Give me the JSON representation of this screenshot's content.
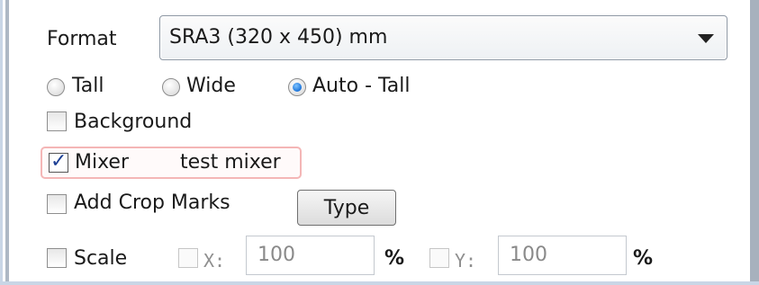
{
  "format": {
    "label": "Format",
    "selected": "SRA3 (320 x 450) mm"
  },
  "orientation": {
    "options": [
      {
        "label": "Tall",
        "checked": false
      },
      {
        "label": "Wide",
        "checked": false
      },
      {
        "label": "Auto - Tall",
        "checked": true
      }
    ]
  },
  "background": {
    "label": "Background",
    "checked": false
  },
  "mixer": {
    "label": "Mixer",
    "value": "test mixer",
    "checked": true
  },
  "crop_marks": {
    "label": "Add Crop Marks",
    "checked": false,
    "type_button": "Type"
  },
  "scale": {
    "label": "Scale",
    "checked": false,
    "x_label": "X:",
    "x_value": "100",
    "x_unit": "%",
    "y_label": "Y:",
    "y_value": "100",
    "y_unit": "%"
  },
  "colors": {
    "accent": "#1a73d9",
    "highlight_border": "#f4b6b6"
  }
}
